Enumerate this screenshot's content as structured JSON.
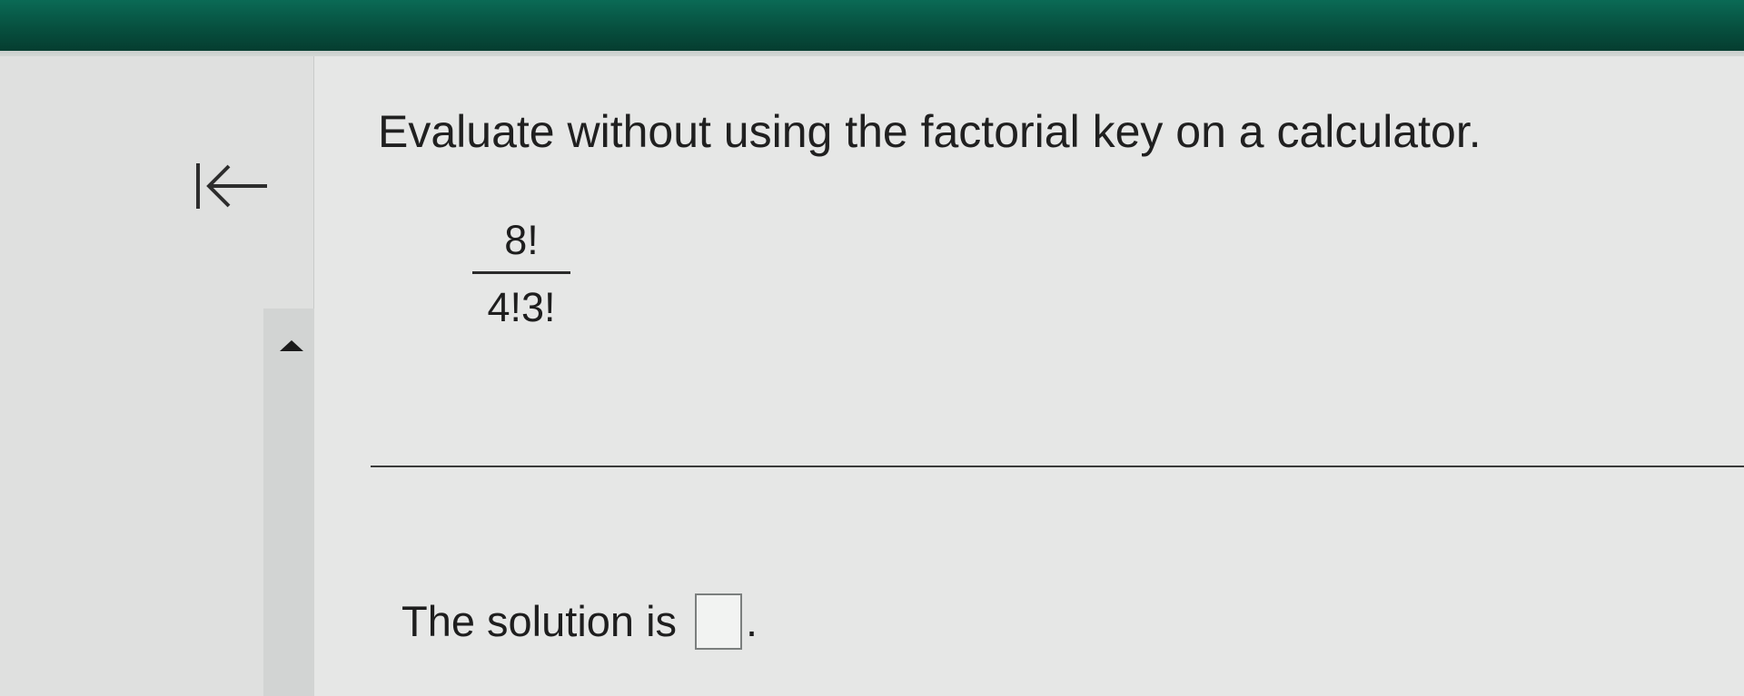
{
  "question": {
    "instruction": "Evaluate without using the factorial key on a calculator.",
    "numerator": "8!",
    "denominator": "4!3!"
  },
  "answer": {
    "prompt": "The solution is",
    "value": "",
    "period": "."
  },
  "icons": {
    "first_question": "first-question-arrow-icon",
    "scroll_up": "scroll-up-triangle-icon"
  },
  "colors": {
    "header": "#07503f",
    "background": "#e6e7e6"
  }
}
